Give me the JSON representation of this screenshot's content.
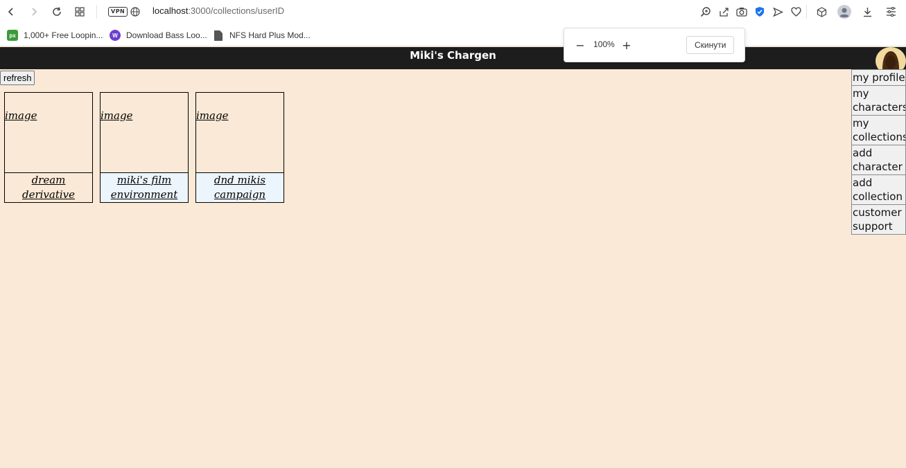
{
  "browser": {
    "url_host": "localhost",
    "url_path": ":3000/collections/userID",
    "vpn_label": "VPN",
    "bookmarks": [
      {
        "label": "1,000+ Free Loopin...",
        "icon": "px-icon",
        "icon_text": "px",
        "color": "#3a9b3a"
      },
      {
        "label": "Download Bass Loo...",
        "icon": "wave-icon",
        "icon_text": "W",
        "color": "#6b3fd1"
      },
      {
        "label": "NFS Hard Plus Mod...",
        "icon": "file-icon",
        "icon_text": "",
        "color": "#555555"
      }
    ],
    "zoom": {
      "level": "100%",
      "minus": "−",
      "plus": "+",
      "reset_label": "Скинути"
    }
  },
  "app": {
    "title": "Miki's Chargen",
    "refresh_label": "refresh",
    "collections": [
      {
        "image_alt": "image",
        "name": "dream derivative"
      },
      {
        "image_alt": "image",
        "name": "miki's film environment"
      },
      {
        "image_alt": "image",
        "name": "dnd mikis campaign"
      }
    ],
    "menu": [
      "my profile",
      "my characters",
      "my collections",
      "add character",
      "add collection",
      "customer support"
    ]
  },
  "colors": {
    "page_bg": "#f9e9d6",
    "header_bg": "#1d1d1d",
    "caption_highlight": "#edf5fc",
    "shield_blue": "#1a73e8"
  }
}
